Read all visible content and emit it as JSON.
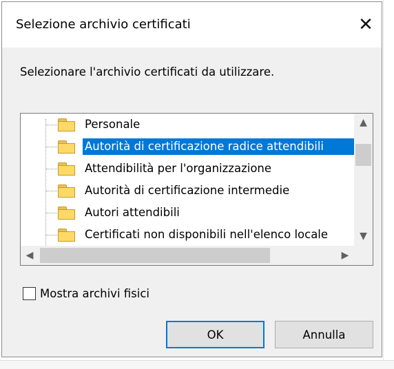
{
  "dialog": {
    "title": "Selezione archivio certificati",
    "instruction": "Selezionare l'archivio certificati da utilizzare."
  },
  "tree": {
    "items": [
      {
        "label": "Personale",
        "selected": false
      },
      {
        "label": "Autorità di certificazione radice attendibili",
        "selected": true
      },
      {
        "label": "Attendibilità per l'organizzazione",
        "selected": false
      },
      {
        "label": "Autorità di certificazione intermedie",
        "selected": false
      },
      {
        "label": "Autori attendibili",
        "selected": false
      },
      {
        "label": "Certificati non disponibili nell'elenco locale",
        "selected": false
      }
    ]
  },
  "options": {
    "show_physical_label": "Mostra archivi fisici",
    "show_physical_checked": false
  },
  "buttons": {
    "ok_label": "OK",
    "cancel_label": "Annulla"
  },
  "icons": {
    "close": "close-icon",
    "folder": "folder-icon",
    "scroll_up": "chevron-up-icon",
    "scroll_down": "chevron-down-icon",
    "scroll_left": "chevron-left-icon",
    "scroll_right": "chevron-right-icon"
  },
  "colors": {
    "selection": "#0078d7",
    "dialog_bg": "#f0f0f0",
    "folder": "#ffd966"
  }
}
